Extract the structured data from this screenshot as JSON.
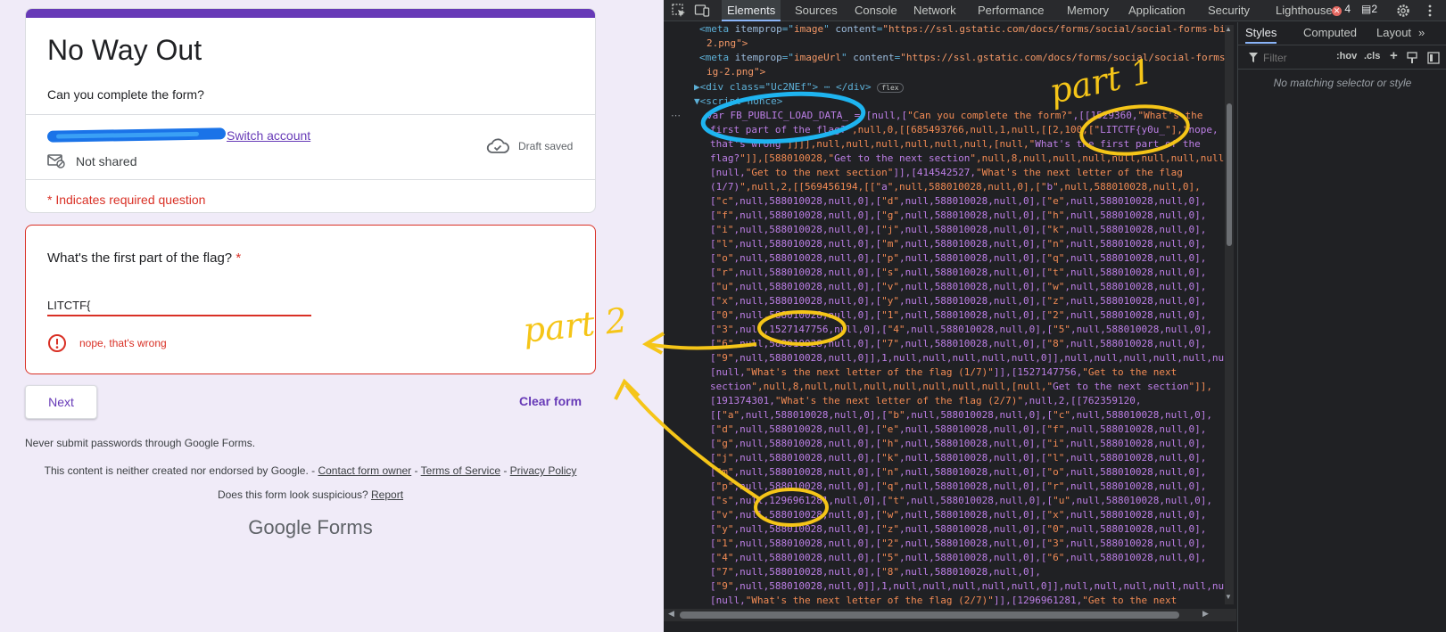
{
  "form": {
    "title": "No Way Out",
    "description": "Can you complete the form?",
    "switch_account": "Switch account",
    "not_shared": "Not shared",
    "draft_saved": "Draft saved",
    "required_note": "* Indicates required question",
    "question": {
      "label": "What's the first part of the flag?",
      "required_mark": "*",
      "answer": "LITCTF{",
      "error": "nope, that's wrong"
    },
    "next_label": "Next",
    "clear_label": "Clear form",
    "password_warning": "Never submit passwords through Google Forms.",
    "footer": {
      "notice": "This content is neither created nor endorsed by Google. - ",
      "contact": "Contact form owner",
      "sep": " - ",
      "terms": "Terms of Service",
      "privacy": "Privacy Policy",
      "suspicious": "Does this form look suspicious? ",
      "report": "Report"
    },
    "logo": {
      "google": "Google",
      "forms": "Forms"
    }
  },
  "annotations": {
    "part1": "part 1",
    "part2": "part 2"
  },
  "devtools": {
    "tabs": [
      "Elements",
      "Sources",
      "Console",
      "Network",
      "Performance",
      "Memory",
      "Application",
      "Security",
      "Lighthouse"
    ],
    "active_tab": "Elements",
    "errors": "4",
    "messages": "2",
    "styles_tabs": [
      "Styles",
      "Computed",
      "Layout",
      "»"
    ],
    "filter_placeholder": "Filter",
    "hov": ":hov",
    "cls": ".cls",
    "plus": "+",
    "no_match": "No matching selector or style",
    "code": {
      "meta1_a": "<meta ",
      "meta1_attr": "itemprop",
      "meta1_eq": "=\"",
      "meta1_val": "image",
      "meta1_c": "\" ",
      "meta1_attr2": "content",
      "meta1_url": "\"https://ssl.gstatic.com/docs/forms/social/social-forms-bi",
      "meta1_url2": "2.png\">",
      "meta2_val": "imageUrl",
      "meta2_url": "\"https://ssl.gstatic.com/docs/forms/social/social-forms",
      "meta2_url2": "ig-2.png\">",
      "div_line": "▶<div class=\"Uc2NEf\"> ⋯ </div>",
      "flex": "flex",
      "script_line": "▼<script nonce>",
      "js_lines": [
        "var FB_PUBLIC_LOAD_DATA_ = [null,[\"Can you complete the form?\",[[1529360,\"What's the",
        "first part of the flag?\",null,0,[[685493766,null,1,null,[[2,100,[\"LITCTF{y0u_\"],\"nope,",
        "that's wrong\"]]]],null,null,null,null,null,null,[null,\"What's the first part of the",
        "flag?\"]],[588010028,\"Get to the next section\",null,8,null,null,null,null,null,null,null,",
        "[null,\"Get to the next section\"]],[414542527,\"What's the next letter of the flag",
        "(1/7)\",null,2,[[569456194,[[\"a\",null,588010028,null,0],[\"b\",null,588010028,null,0],",
        "[\"c\",null,588010028,null,0],[\"d\",null,588010028,null,0],[\"e\",null,588010028,null,0],",
        "[\"f\",null,588010028,null,0],[\"g\",null,588010028,null,0],[\"h\",null,588010028,null,0],",
        "[\"i\",null,588010028,null,0],[\"j\",null,588010028,null,0],[\"k\",null,588010028,null,0],",
        "[\"l\",null,588010028,null,0],[\"m\",null,588010028,null,0],[\"n\",null,588010028,null,0],",
        "[\"o\",null,588010028,null,0],[\"p\",null,588010028,null,0],[\"q\",null,588010028,null,0],",
        "[\"r\",null,588010028,null,0],[\"s\",null,588010028,null,0],[\"t\",null,588010028,null,0],",
        "[\"u\",null,588010028,null,0],[\"v\",null,588010028,null,0],[\"w\",null,588010028,null,0],",
        "[\"x\",null,588010028,null,0],[\"y\",null,588010028,null,0],[\"z\",null,588010028,null,0],",
        "[\"0\",null,588010028,null,0],[\"1\",null,588010028,null,0],[\"2\",null,588010028,null,0],",
        "[\"3\",null,1527147756,null,0],[\"4\",null,588010028,null,0],[\"5\",null,588010028,null,0],",
        "[\"6\",null,588010028,null,0],[\"7\",null,588010028,null,0],[\"8\",null,588010028,null,0],",
        "[\"9\",null,588010028,null,0]],1,null,null,null,null,null,0]],null,null,null,null,null,nu",
        "[null,\"What's the next letter of the flag (1/7)\"]],[1527147756,\"Get to the next",
        "section\",null,8,null,null,null,null,null,null,null,[null,\"Get to the next section\"]],",
        "[191374301,\"What's the next letter of the flag (2/7)\",null,2,[[762359120,",
        "[[\"a\",null,588010028,null,0],[\"b\",null,588010028,null,0],[\"c\",null,588010028,null,0],",
        "[\"d\",null,588010028,null,0],[\"e\",null,588010028,null,0],[\"f\",null,588010028,null,0],",
        "[\"g\",null,588010028,null,0],[\"h\",null,588010028,null,0],[\"i\",null,588010028,null,0],",
        "[\"j\",null,588010028,null,0],[\"k\",null,588010028,null,0],[\"l\",null,588010028,null,0],",
        "[\"m\",null,588010028,null,0],[\"n\",null,588010028,null,0],[\"o\",null,588010028,null,0],",
        "[\"p\",null,588010028,null,0],[\"q\",null,588010028,null,0],[\"r\",null,588010028,null,0],",
        "[\"s\",null,1296961281,null,0],[\"t\",null,588010028,null,0],[\"u\",null,588010028,null,0],",
        "[\"v\",null,588010028,null,0],[\"w\",null,588010028,null,0],[\"x\",null,588010028,null,0],",
        "[\"y\",null,588010028,null,0],[\"z\",null,588010028,null,0],[\"0\",null,588010028,null,0],",
        "[\"1\",null,588010028,null,0],[\"2\",null,588010028,null,0],[\"3\",null,588010028,null,0],",
        "[\"4\",null,588010028,null,0],[\"5\",null,588010028,null,0],[\"6\",null,588010028,null,0],",
        "[\"7\",null,588010028,null,0],[\"8\",null,588010028,null,0],",
        "[\"9\",null,588010028,null,0]],1,null,null,null,null,null,0]],null,null,null,null,null,nu",
        "[null,\"What's the next letter of the flag (2/7)\"]],[1296961281,\"Get to the next"
      ]
    }
  },
  "colors": {
    "form_accent": "#673ab7",
    "error_red": "#d93025",
    "annotation_yellow": "#f5c518",
    "annotation_blue": "#1eb4f0"
  }
}
